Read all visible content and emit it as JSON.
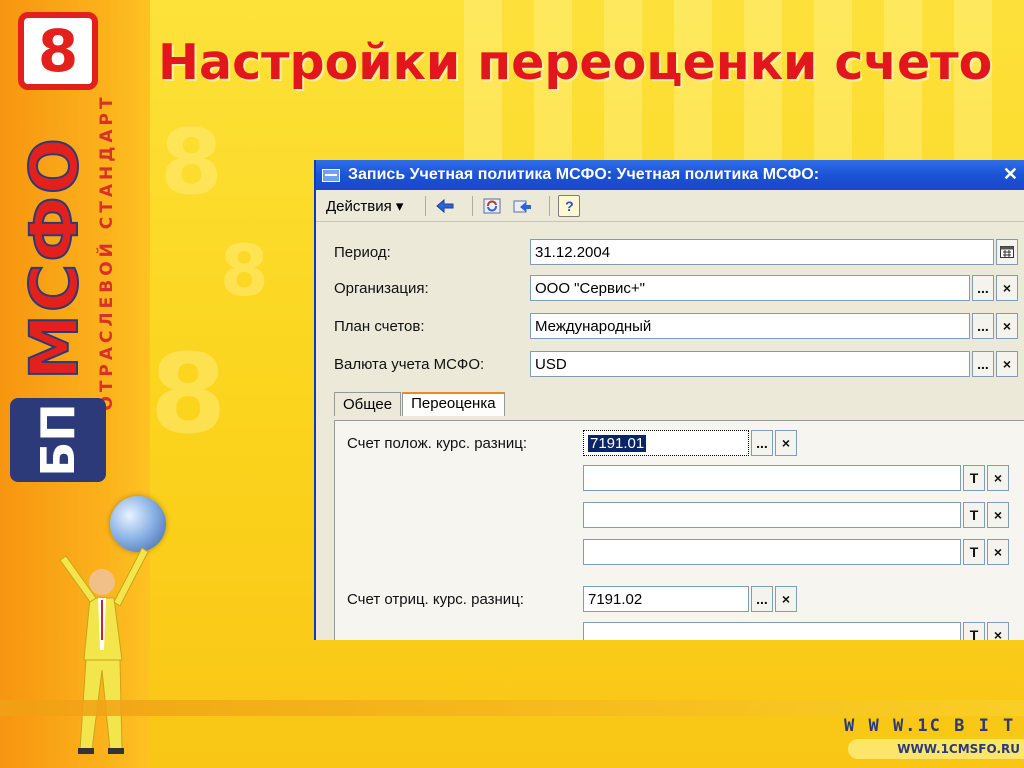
{
  "slide": {
    "title": "Настройки переоценки счето",
    "logo": {
      "digit": "8",
      "brand": "МСФО",
      "badge": "БП",
      "subtitle": "ОТРАСЛЕВОЙ СТАНДАРТ"
    },
    "footer": {
      "url1": "W W W.1C B I T .",
      "url2": "WWW.1CMSFO.RU"
    }
  },
  "window": {
    "title": "Запись Учетная политика МСФО: Учетная политика МСФО:",
    "close_glyph": "✕",
    "toolbar": {
      "actions_label": "Действия ▾",
      "help_glyph": "?"
    }
  },
  "form": {
    "period": {
      "label": "Период:",
      "value": "31.12.2004"
    },
    "organization": {
      "label": "Организация:",
      "value": "ООО \"Сервис+\""
    },
    "chart_of_accounts": {
      "label": "План счетов:",
      "value": "Международный"
    },
    "currency": {
      "label": "Валюта учета МСФО:",
      "value": "USD"
    },
    "tabs": [
      {
        "label": "Общее"
      },
      {
        "label": "Переоценка"
      }
    ],
    "positive_diff": {
      "label": "Счет полож. курс. разниц:",
      "value": "7191.01"
    },
    "negative_diff": {
      "label": "Счет отриц. курс. разниц:",
      "value": "7191.02"
    },
    "buttons": {
      "select": "...",
      "clear": "×",
      "type": "T"
    }
  }
}
